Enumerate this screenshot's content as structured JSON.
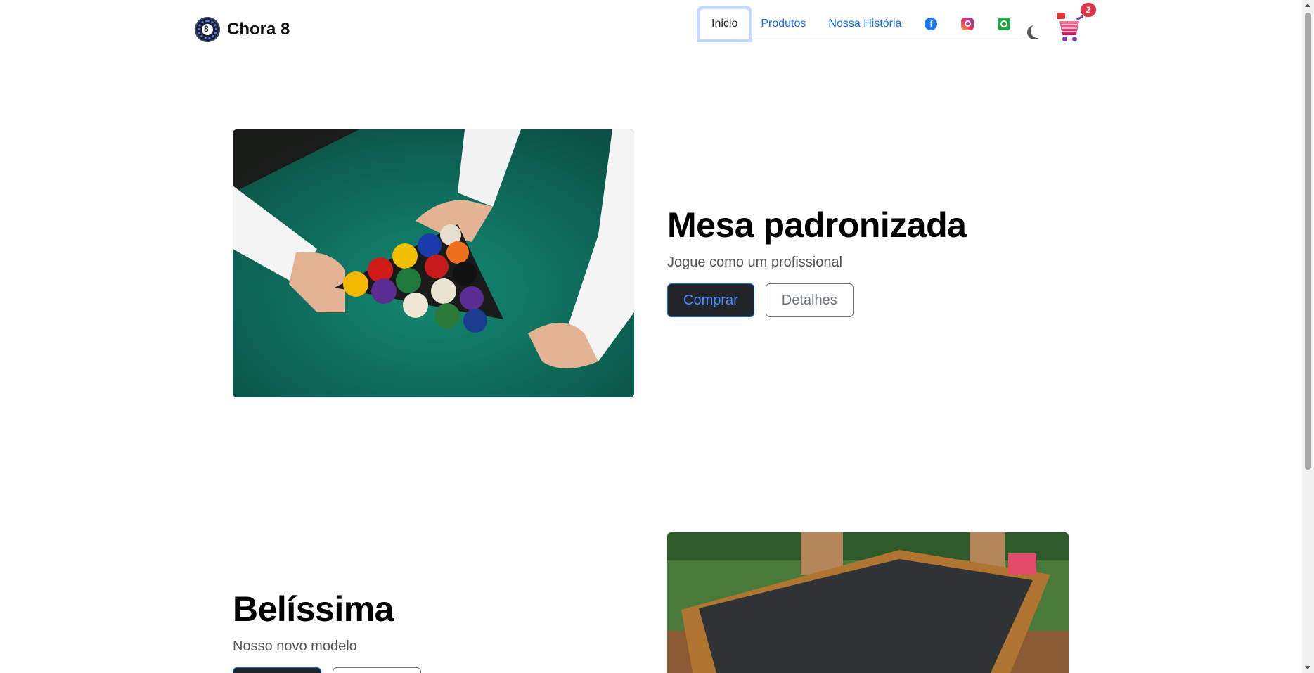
{
  "navbar": {
    "brand_name": "Chora 8",
    "links": [
      {
        "label": "Inicio",
        "active": true
      },
      {
        "label": "Produtos",
        "active": false
      },
      {
        "label": "Nossa História",
        "active": false
      }
    ],
    "social_icons": [
      "facebook-icon",
      "instagram-icon",
      "whatsapp-icon"
    ],
    "theme_toggle_icon": "moon-icon",
    "cart": {
      "icon": "shopping-cart-icon",
      "count": "2"
    }
  },
  "featurettes": [
    {
      "title": "Mesa padronizada",
      "subtitle": "Jogue como um profissional",
      "primary_button": "Comprar",
      "secondary_button": "Detalhes",
      "image": "billiard-balls-rack-photo"
    },
    {
      "title": "Belíssima",
      "subtitle": "Nosso novo modelo",
      "primary_button": "",
      "secondary_button": "",
      "image": "pool-table-photo"
    }
  ],
  "colors": {
    "primary": "#0d6efd",
    "dark": "#212529",
    "badge": "#dc3545",
    "felt_green": "#0f6b5a"
  }
}
